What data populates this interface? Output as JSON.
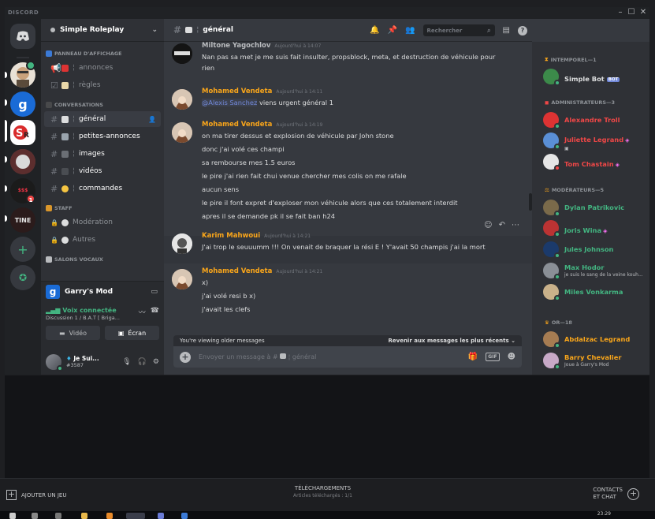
{
  "window": {
    "brand": "DISCORD",
    "controls": [
      "–",
      "☐",
      "✕"
    ]
  },
  "colors": {
    "online": "#43b581",
    "dnd": "#f04747",
    "accent": "#7289da",
    "orange": "#f5a623",
    "yellow": "#faa61a"
  },
  "guild": {
    "name": "Simple Roleplay"
  },
  "categories": {
    "panneau": "PANNEAU D'AFFICHAGE",
    "conversations": "CONVERSATIONS",
    "staff": "STAFF",
    "vocaux": "SALONS VOCAUX"
  },
  "channels": {
    "annonces": "annonces",
    "regles": "règles",
    "general": "général",
    "petites_annonces": "petites-annonces",
    "images": "images",
    "videos": "vidéos",
    "commandes": "commandes",
    "moderation": "Modération",
    "autres": "Autres"
  },
  "activity": {
    "game": "Garry's Mod"
  },
  "voice": {
    "status": "Voix connectée",
    "location": "Discussion 1 / B.A.T [ Briga...",
    "video_label": "Vidéo",
    "screen_label": "Écran"
  },
  "user": {
    "name": "Je Sui...",
    "tag": "#3587"
  },
  "chat": {
    "channel_title": "général",
    "search_placeholder": "Rechercher",
    "older_notice": "You're viewing older messages",
    "jump_label": "Revenir aux messages les plus récents",
    "composer_placeholder": "Envoyer un message à #",
    "composer_channel": "général",
    "gif_label": "GIF"
  },
  "messages": [
    {
      "author": "Miltone Yagochlov",
      "color": "#b9bbbe",
      "timestamp": "Aujourd'hui à 14:07",
      "lines": [
        "Nan pas sa met je me suis fait insulter, propsblock, meta, et destruction de véhicule pour",
        "rien"
      ]
    },
    {
      "author": "Mohamed Vendeta",
      "color": "#faa61a",
      "timestamp": "Aujourd'hui à 14:11",
      "mention": "@Alexis Sanchez",
      "lines": [
        " viens urgent général 1"
      ]
    },
    {
      "author": "Mohamed Vendeta",
      "color": "#faa61a",
      "timestamp": "Aujourd'hui à 14:19",
      "lines": [
        "on ma tirer dessus et explosion de véhicule par John stone",
        "donc j'ai volé ces champi",
        "sa rembourse mes 1.5 euros",
        "le pire j'ai rien fait chui venue chercher mes colis on me rafale",
        "aucun sens",
        "le pire il font expret d'exploser mon véhicule alors que ces totalement interdit",
        "apres il se demande pk il se fait ban h24"
      ]
    },
    {
      "author": "Karim Mahwoui",
      "color": "#faa61a",
      "timestamp": "Aujourd'hui à 14:21",
      "lines": [
        "J'ai trop le seuuumm !!! On venait de braquer la rési E ! Y'avait 50 champis j'ai la mort"
      ]
    },
    {
      "author": "Mohamed Vendeta",
      "color": "#faa61a",
      "timestamp": "Aujourd'hui à 14:21",
      "lines": [
        "x)",
        "j'ai volé resi b x)",
        "j'avait les clefs"
      ]
    }
  ],
  "members": {
    "groups": [
      {
        "label": "INTEMPOREL—1"
      },
      {
        "label": "ADMINISTRATEURS—3"
      },
      {
        "label": "MODÉRATEURS—5"
      },
      {
        "label": "OR—18"
      }
    ],
    "list": [
      {
        "name": "Simple Bot",
        "color": "#dcddde",
        "bot": "BOT"
      },
      {
        "name": "Alexandre Troll",
        "color": "#f04747"
      },
      {
        "name": "Juliette Legrand",
        "color": "#f04747"
      },
      {
        "name": "Tom Chastain",
        "color": "#f04747"
      },
      {
        "name": "Dylan Patrikovic",
        "color": "#43b581"
      },
      {
        "name": "Joris Wina",
        "color": "#43b581"
      },
      {
        "name": "Jules Johnson",
        "color": "#43b581"
      },
      {
        "name": "Max Hodor",
        "color": "#43b581",
        "sub": "je suis le sang de la veine kouh..."
      },
      {
        "name": "Miles Vonkarma",
        "color": "#43b581"
      },
      {
        "name": "Abdalzac Legrand",
        "color": "#faa61a"
      },
      {
        "name": "Barry Chevalier",
        "color": "#faa61a",
        "sub": "Joue à Garry's Mod"
      }
    ]
  },
  "steam": {
    "add_game": "AJOUTER UN JEU",
    "downloads": "TÉLÉCHARGEMENTS",
    "downloads_sub": "Articles téléchargés : 1/1",
    "contacts": "CONTACTS",
    "chat": "ET CHAT"
  },
  "taskbar": {
    "clock": "23:29"
  }
}
